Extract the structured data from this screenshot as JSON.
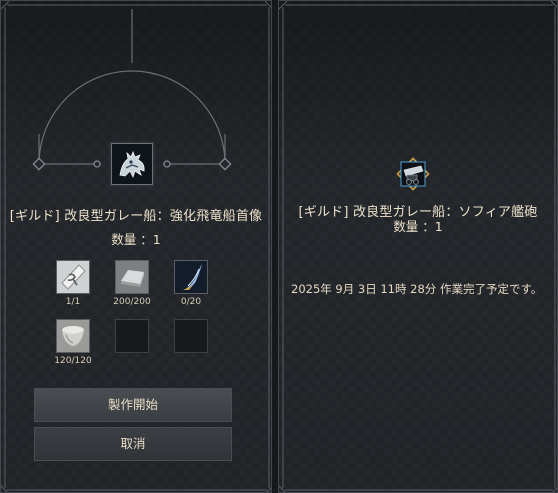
{
  "craft": {
    "item_name": "[ギルド] 改良型ガレー船：強化飛竜船首像",
    "quantity_label": "数量 ：1",
    "materials": [
      {
        "count": "1/1",
        "icon": "scroll-icon"
      },
      {
        "count": "200/200",
        "icon": "ingot-icon"
      },
      {
        "count": "0/20",
        "icon": "flame-feather-icon"
      },
      {
        "count": "120/120",
        "icon": "bowl-icon"
      }
    ],
    "buttons": {
      "start": "製作開始",
      "cancel": "取消"
    }
  },
  "progress": {
    "item_name": "[ギルド] 改良型ガレー船：ソフィア艦砲",
    "quantity_label": "数量 ：1",
    "completion_text": "2025年 9月 3日 11時 28分 作業完了予定です。"
  },
  "colors": {
    "panel_bg": "#24272b",
    "text": "#e3d8c3",
    "accent_blue": "#4da3d8",
    "accent_gold": "#c79a49"
  }
}
